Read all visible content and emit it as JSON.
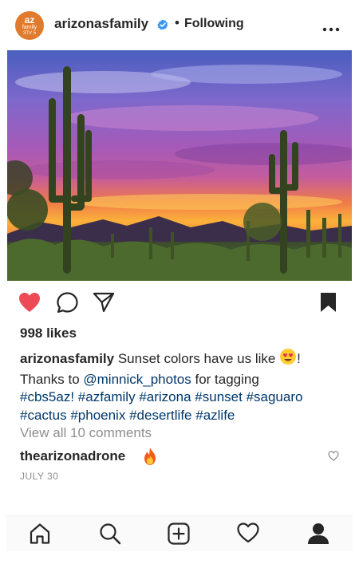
{
  "header": {
    "avatar_text": [
      "az",
      "family",
      "3TV 5"
    ],
    "username": "arizonasfamily",
    "separator": "•",
    "follow_status": "Following"
  },
  "post": {
    "likes": "998 likes",
    "caption_user": "arizonasfamily",
    "caption_part1": " Sunset colors have us like ",
    "caption_part2": "! Thanks to ",
    "mention": "@minnick_photos",
    "caption_part3": " for tagging",
    "hashtags": [
      "#cbs5az!",
      "#azfamily",
      "#arizona",
      "#sunset",
      "#saguaro",
      "#cactus",
      "#phoenix",
      "#desertlife",
      "#azlife"
    ],
    "view_comments": "View all 10 comments",
    "comment_user": "thearizonadrone",
    "date": "JULY 30"
  },
  "icons": {
    "verified": "verified-badge-icon",
    "more": "more-options-icon",
    "like": "heart-icon",
    "comment": "comment-icon",
    "share": "share-icon",
    "save": "bookmark-icon",
    "fire": "fire-emoji-icon",
    "heart_eyes": "heart-eyes-emoji-icon",
    "tab_home": "home-icon",
    "tab_search": "search-icon",
    "tab_add": "add-post-icon",
    "tab_activity": "activity-heart-icon",
    "tab_profile": "profile-icon"
  },
  "colors": {
    "like_red": "#ed4956",
    "link_blue": "#00376b",
    "verified_blue": "#3897f0",
    "muted_gray": "#8e8e8e",
    "brand_orange": "#e07a2c"
  }
}
